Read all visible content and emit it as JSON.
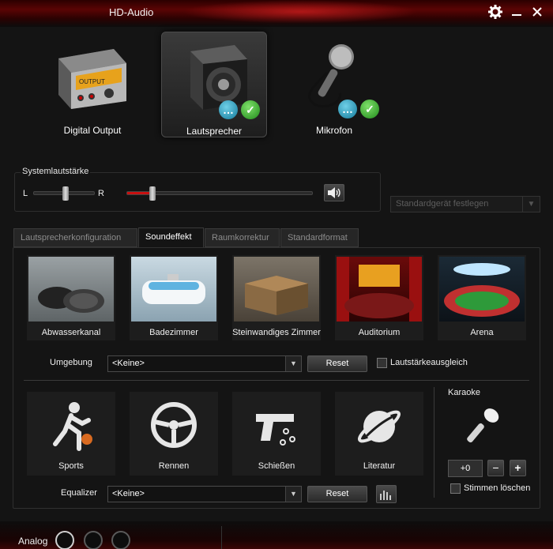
{
  "window": {
    "title": "HD-Audio",
    "icons": [
      "gear-icon",
      "minimize-icon",
      "close-icon"
    ]
  },
  "devices": [
    {
      "label": "Digital Output"
    },
    {
      "label": "Lautsprecher"
    },
    {
      "label": "Mikrofon"
    }
  ],
  "volume": {
    "title": "Systemlautstärke",
    "left_label": "L",
    "right_label": "R"
  },
  "default_device": {
    "label": "Standardgerät festlegen"
  },
  "tabs": [
    {
      "label": "Lautsprecherkonfiguration"
    },
    {
      "label": "Soundeffekt"
    },
    {
      "label": "Raumkorrektur"
    },
    {
      "label": "Standardformat"
    }
  ],
  "effects": [
    {
      "label": "Abwasserkanal"
    },
    {
      "label": "Badezimmer"
    },
    {
      "label": "Steinwandiges Zimmer"
    },
    {
      "label": "Auditorium"
    },
    {
      "label": "Arena"
    }
  ],
  "environment": {
    "label": "Umgebung",
    "value": "<Keine>",
    "reset": "Reset",
    "loudness": "Lautstärkeausgleich"
  },
  "genres": [
    {
      "label": "Sports"
    },
    {
      "label": "Rennen"
    },
    {
      "label": "Schießen"
    },
    {
      "label": "Literatur"
    }
  ],
  "equalizer": {
    "label": "Equalizer",
    "value": "<Keine>",
    "reset": "Reset"
  },
  "karaoke": {
    "title": "Karaoke",
    "value": "+0",
    "minus": "−",
    "plus": "+",
    "voice_cancel": "Stimmen löschen"
  },
  "bottom": {
    "analog_label": "Analog"
  },
  "colors": {
    "accent_red": "#c81010",
    "ok_green": "#2aa02a",
    "chat_blue": "#1e90b0"
  }
}
